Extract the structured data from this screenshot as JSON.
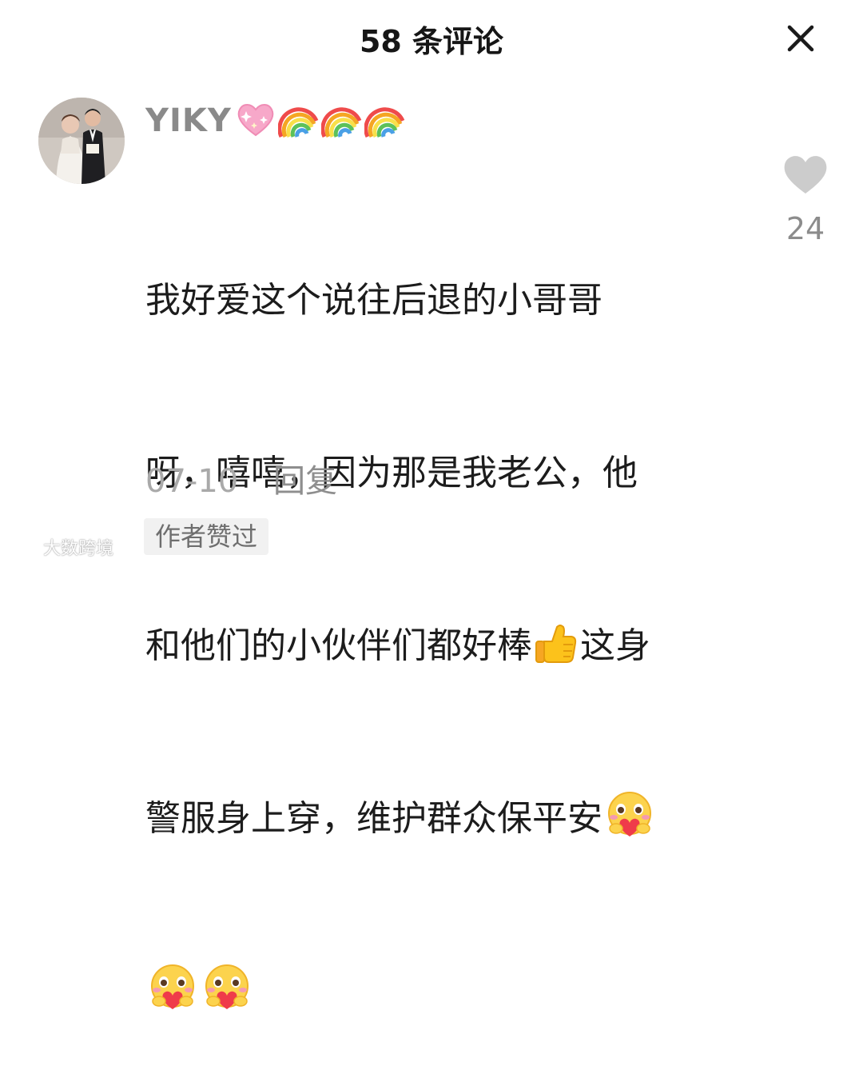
{
  "header": {
    "title": "58 条评论",
    "close_icon": "close-icon"
  },
  "comment": {
    "avatar_icon": "avatar-wedding-photo",
    "username": "YIKY",
    "username_emojis": [
      "sparkling-heart-icon",
      "rainbow-icon",
      "rainbow-icon",
      "rainbow-icon"
    ],
    "lines": [
      {
        "text": "我好爱这个说往后退的小哥哥",
        "emoji_after": null
      },
      {
        "text": "呀，嘻嘻，因为那是我老公，他",
        "emoji_after": null
      },
      {
        "text_before": "和他们的小伙伴们都好棒",
        "emoji": "thumbs-up-icon",
        "text_after": "这身"
      },
      {
        "text_before": "警服身上穿，维护群众保平安",
        "emoji": "heart-hug-face-icon",
        "text_after": ""
      },
      {
        "emojis": [
          "heart-hug-face-icon",
          "heart-hug-face-icon"
        ]
      }
    ],
    "like_icon": "heart-icon",
    "like_count": "24",
    "date": "07-10",
    "reply_label": "回复",
    "author_liked_badge": "作者赞过"
  },
  "watermark": {
    "text": "大数跨境"
  },
  "colors": {
    "title": "#161616",
    "username": "#8a8a8a",
    "body_text": "#1c1c1c",
    "meta": "#a9a9a9",
    "like_icon": "#cccccc",
    "badge_bg": "#f1f1f1"
  }
}
